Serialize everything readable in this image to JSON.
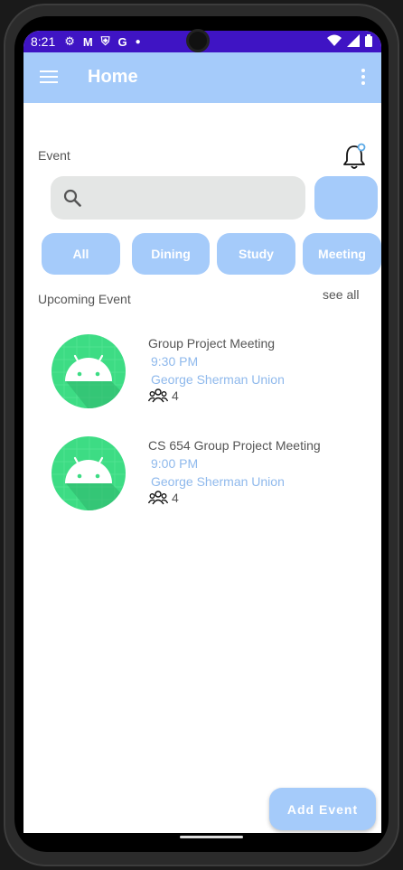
{
  "status_bar": {
    "time": "8:21",
    "icons_left": [
      "settings-icon",
      "gmail-icon",
      "shield-icon",
      "google-icon",
      "dot-icon"
    ],
    "icons_right": [
      "wifi-icon",
      "signal-icon",
      "battery-icon"
    ],
    "color": "#3f14c4"
  },
  "app_bar": {
    "title": "Home",
    "color": "#a5cbfa"
  },
  "event_section": {
    "label": "Event",
    "search": {
      "placeholder": "",
      "value": ""
    }
  },
  "filters": [
    "All",
    "Dining",
    "Study",
    "Meeting"
  ],
  "upcoming": {
    "label": "Upcoming Event",
    "see_all": "see all",
    "events": [
      {
        "title": "Group Project Meeting",
        "time": "9:30 PM",
        "location": "George Sherman Union",
        "attendees": "4"
      },
      {
        "title": "CS 654 Group Project Meeting",
        "time": "9:00 PM",
        "location": "George Sherman Union",
        "attendees": "4"
      }
    ]
  },
  "fab": {
    "label": "Add Event"
  },
  "colors": {
    "accent": "#a5cbfa",
    "link": "#8fb9ec",
    "avatar": "#3ddc84"
  }
}
